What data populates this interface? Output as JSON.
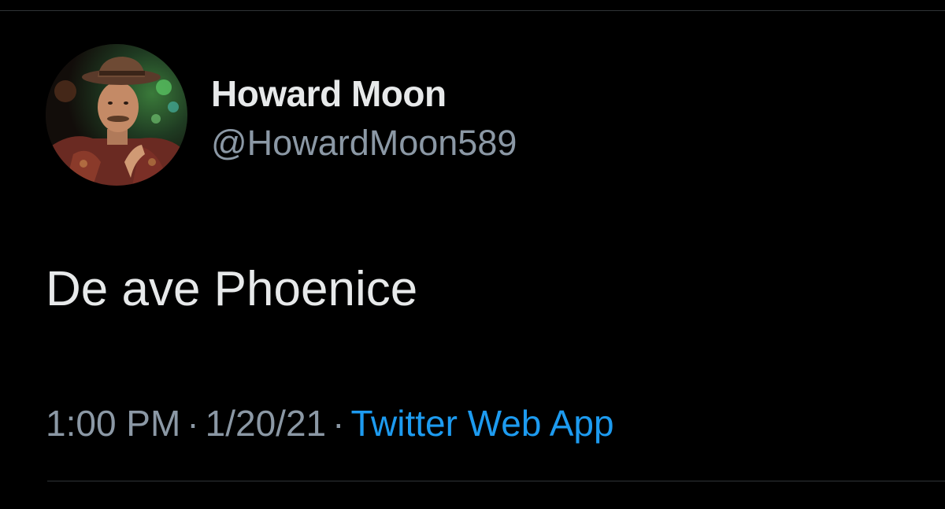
{
  "tweet": {
    "author": {
      "display_name": "Howard Moon",
      "handle": "@HowardMoon589",
      "avatar_icon": "profile-photo"
    },
    "text": "De ave Phoenice",
    "meta": {
      "time": "1:00 PM",
      "separator": "·",
      "date": "1/20/21",
      "source": "Twitter Web App"
    }
  },
  "colors": {
    "background": "#000000",
    "primary_text": "#e7e9ea",
    "secondary_text": "#8b98a5",
    "link": "#1d9bf0",
    "divider": "#2f3336"
  }
}
